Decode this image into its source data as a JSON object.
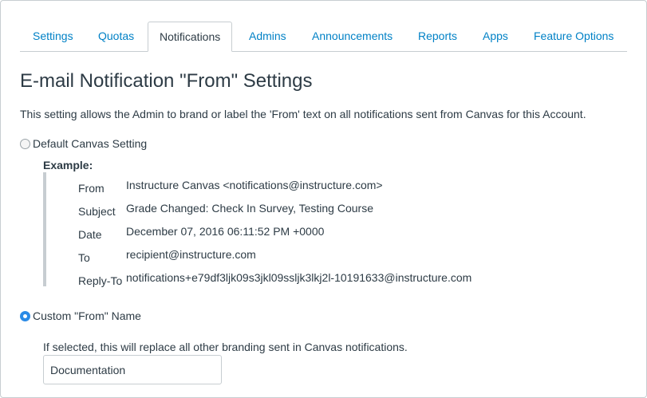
{
  "tabs": [
    {
      "label": "Settings",
      "active": false
    },
    {
      "label": "Quotas",
      "active": false
    },
    {
      "label": "Notifications",
      "active": true
    },
    {
      "label": "Admins",
      "active": false
    },
    {
      "label": "Announcements",
      "active": false
    },
    {
      "label": "Reports",
      "active": false
    },
    {
      "label": "Apps",
      "active": false
    },
    {
      "label": "Feature Options",
      "active": false
    }
  ],
  "page": {
    "title": "E-mail Notification \"From\" Settings",
    "description": "This setting allows the Admin to brand or label the 'From' text on all notifications sent from Canvas for this Account."
  },
  "options": {
    "default_label": "Default Canvas Setting",
    "default_selected": false,
    "custom_label": "Custom \"From\" Name",
    "custom_selected": true
  },
  "example": {
    "label": "Example:",
    "rows": [
      {
        "key": "From",
        "value": "Instructure Canvas <notifications@instructure.com>"
      },
      {
        "key": "Subject",
        "value": "Grade Changed: Check In Survey, Testing Course"
      },
      {
        "key": "Date",
        "value": "December 07, 2016 06:11:52 PM +0000"
      },
      {
        "key": "To",
        "value": "recipient@instructure.com"
      },
      {
        "key": "Reply-To",
        "value": "notifications+e79df3ljk09s3jkl09ssljk3lkj2l-10191633@instructure.com"
      }
    ]
  },
  "custom": {
    "hint": "If selected, this will replace all other branding sent in Canvas notifications.",
    "input_value": "Documentation"
  },
  "colors": {
    "link": "#0081c6",
    "text": "#2d3b45",
    "border": "#c7cdd1",
    "radio_checked": "#2b8be6"
  }
}
